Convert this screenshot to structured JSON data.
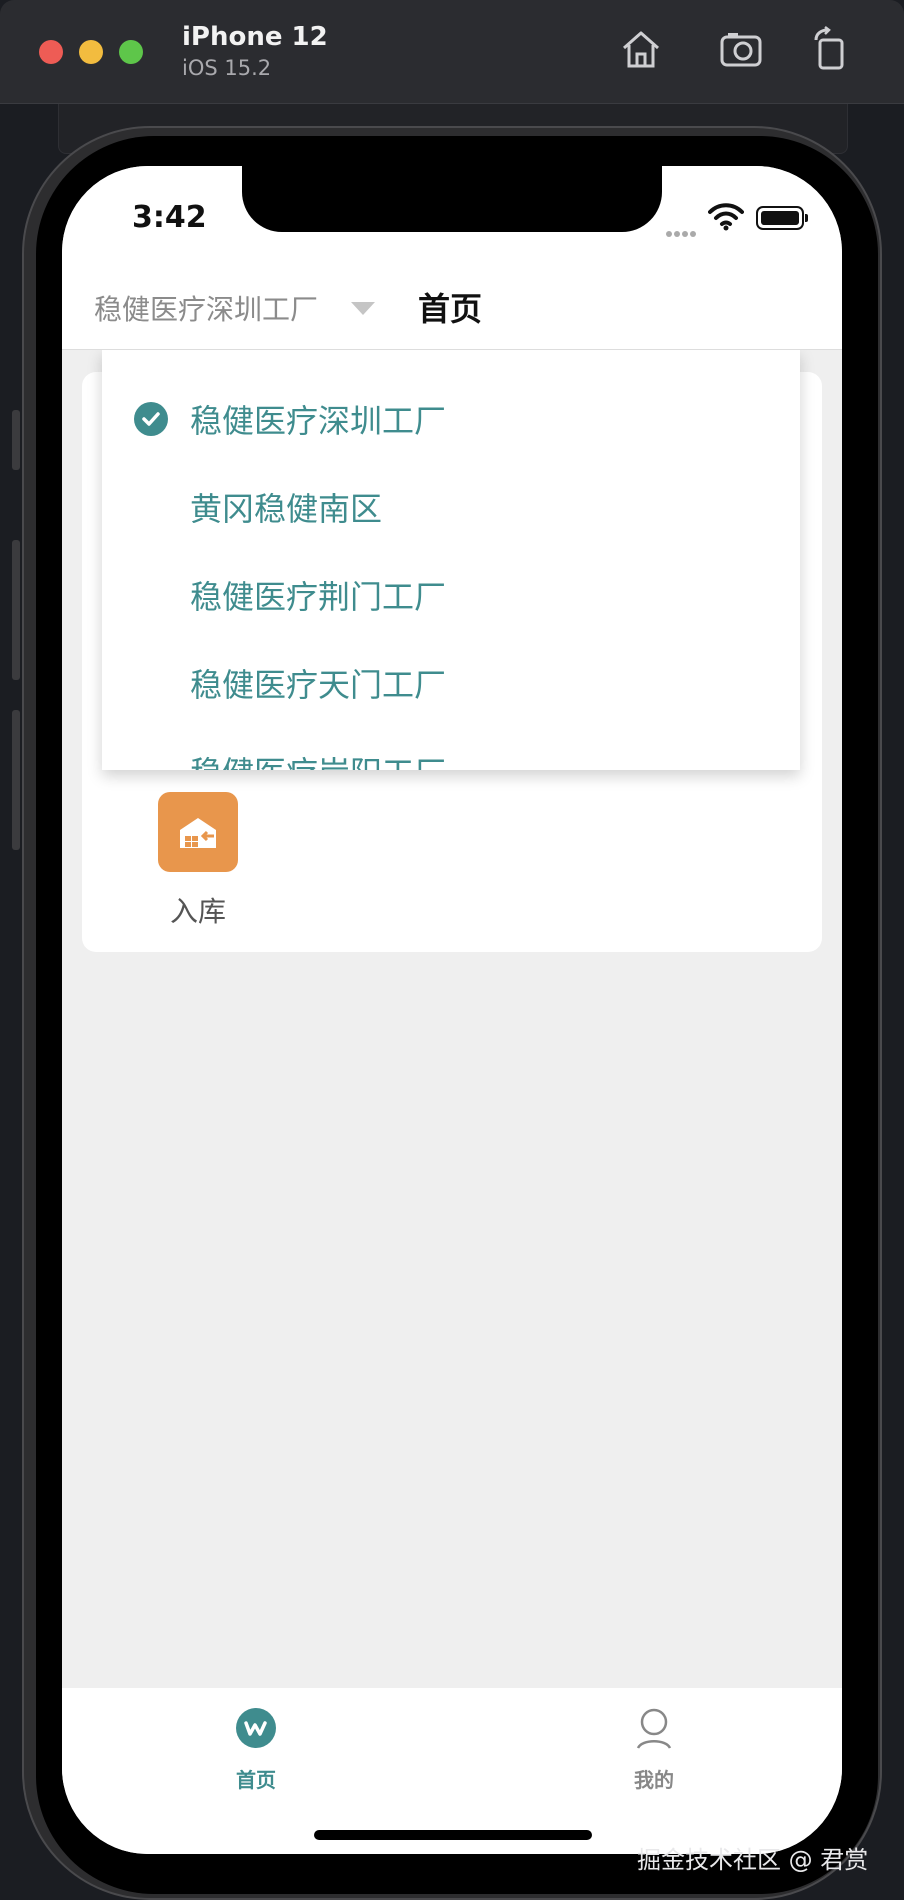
{
  "simulator": {
    "device_name": "iPhone 12",
    "os_version": "iOS 15.2"
  },
  "status_bar": {
    "time": "3:42"
  },
  "nav": {
    "selected_factory": "稳健医疗深圳工厂",
    "title": "首页"
  },
  "dropdown": {
    "items": [
      {
        "label": "稳健医疗深圳工厂",
        "selected": true
      },
      {
        "label": "黄冈稳健南区",
        "selected": false
      },
      {
        "label": "稳健医疗荆门工厂",
        "selected": false
      },
      {
        "label": "稳健医疗天门工厂",
        "selected": false
      },
      {
        "label": "稳健医疗岸阳工厂",
        "selected": false
      }
    ]
  },
  "home_grid": {
    "tiles": [
      {
        "label": "入库",
        "icon": "warehouse-inbound-icon",
        "color": "#e8964c"
      }
    ]
  },
  "tab_bar": {
    "tabs": [
      {
        "label": "首页",
        "icon": "home-logo-icon",
        "active": true
      },
      {
        "label": "我的",
        "icon": "profile-icon",
        "active": false
      }
    ],
    "active_color": "#3f8c8e",
    "inactive_color": "#888888"
  },
  "watermark": "掘金技术社区 @ 君赏"
}
